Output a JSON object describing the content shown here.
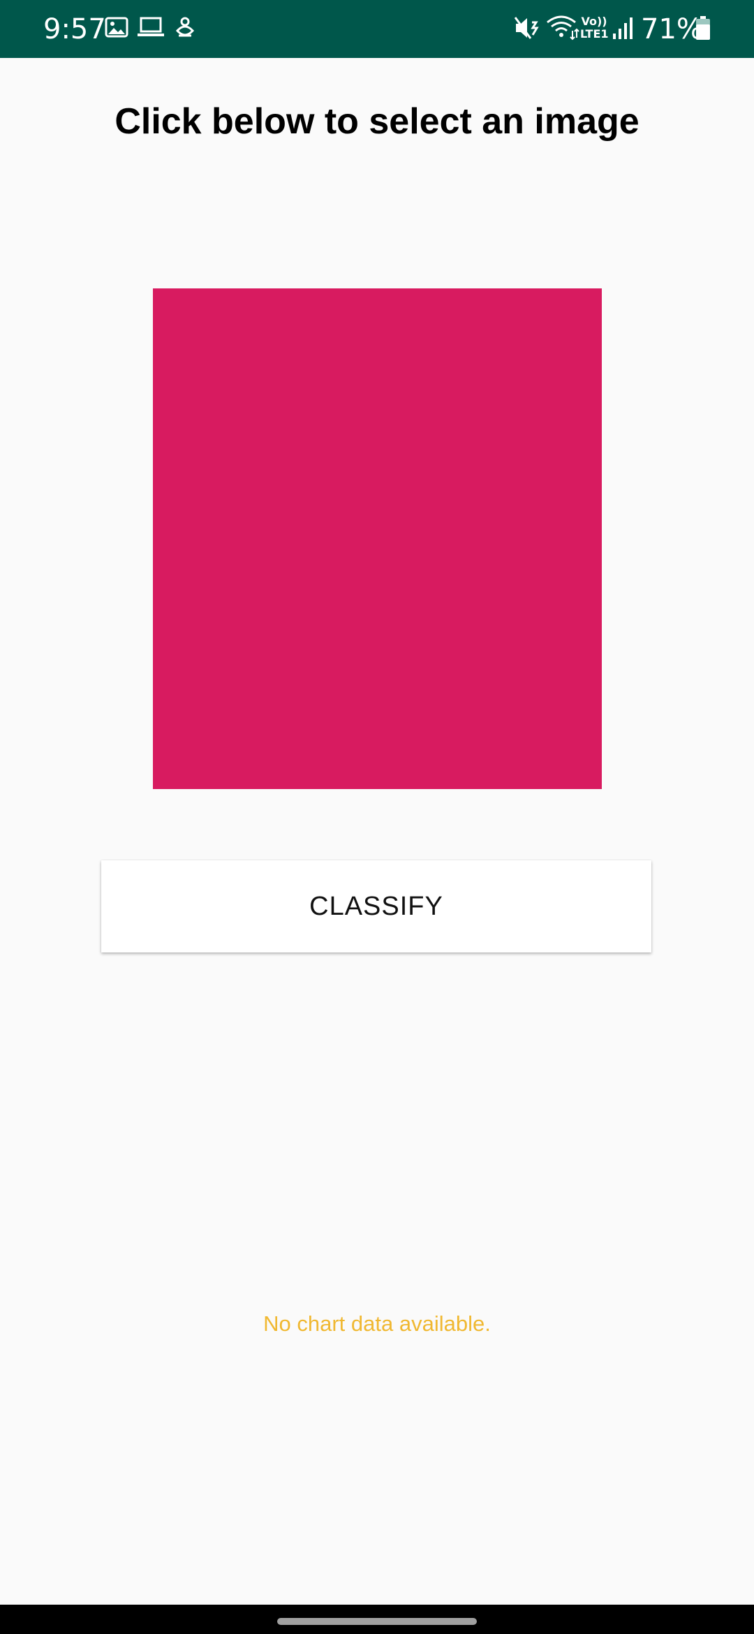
{
  "status_bar": {
    "time": "9:57",
    "battery_percent": "71%",
    "network_label": "Vo))\nLTE1",
    "background_color": "#00574b",
    "icons": [
      "gallery-icon",
      "laptop-icon",
      "bug-icon",
      "mute-icon",
      "wifi-icon",
      "signal-icon",
      "battery-icon"
    ]
  },
  "main": {
    "headline": "Click below to select an image",
    "image_placeholder_color": "#d81b60",
    "classify_label": "CLASSIFY",
    "no_data_text": "No chart data available.",
    "no_data_color": "#f0b831"
  },
  "nav_bar": {
    "handle": "home-handle"
  }
}
